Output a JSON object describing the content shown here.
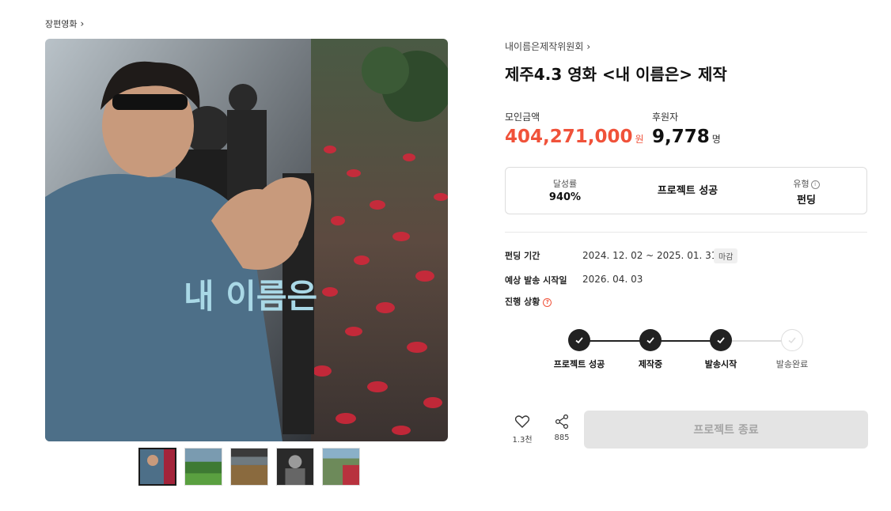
{
  "breadcrumb": {
    "label": "장편영화",
    "chevron": "›"
  },
  "hero": {
    "overlay_text": "내 이름은",
    "thumbnails": [
      {
        "name": "thumb-1",
        "active": true
      },
      {
        "name": "thumb-2",
        "active": false
      },
      {
        "name": "thumb-3",
        "active": false
      },
      {
        "name": "thumb-4",
        "active": false
      },
      {
        "name": "thumb-5",
        "active": false
      }
    ]
  },
  "creator": {
    "name": "내이름은제작위원회",
    "chevron": "›"
  },
  "project": {
    "title": "제주4.3 영화 <내 이름은> 제작"
  },
  "stats": {
    "amount_label": "모인금액",
    "amount_value": "404,271,000",
    "amount_unit": "원",
    "backers_label": "후원자",
    "backers_value": "9,778",
    "backers_unit": "명"
  },
  "summary": {
    "rate_label": "달성률",
    "rate_value": "940%",
    "status": "프로젝트 성공",
    "type_label": "유형",
    "type_value": "펀딩"
  },
  "details": {
    "period_label": "펀딩 기간",
    "period_value": "2024. 12. 02 ~ 2025. 01. 31",
    "period_tag": "마감",
    "ship_label": "예상 발송 시작일",
    "ship_value": "2026. 04. 03",
    "progress_label": "진행 상황"
  },
  "steps": [
    {
      "label": "프로젝트 성공",
      "done": true
    },
    {
      "label": "제작중",
      "done": true
    },
    {
      "label": "발송시작",
      "done": true
    },
    {
      "label": "발송완료",
      "done": false
    }
  ],
  "actions": {
    "like_count": "1.3천",
    "share_count": "885",
    "end_button": "프로젝트 종료"
  },
  "colors": {
    "accent": "#f0523a",
    "step_done": "#222222",
    "button_disabled_bg": "#e4e4e4"
  },
  "icons": [
    "chevron-right-icon",
    "info-icon",
    "help-icon",
    "check-icon",
    "heart-icon",
    "share-icon"
  ]
}
